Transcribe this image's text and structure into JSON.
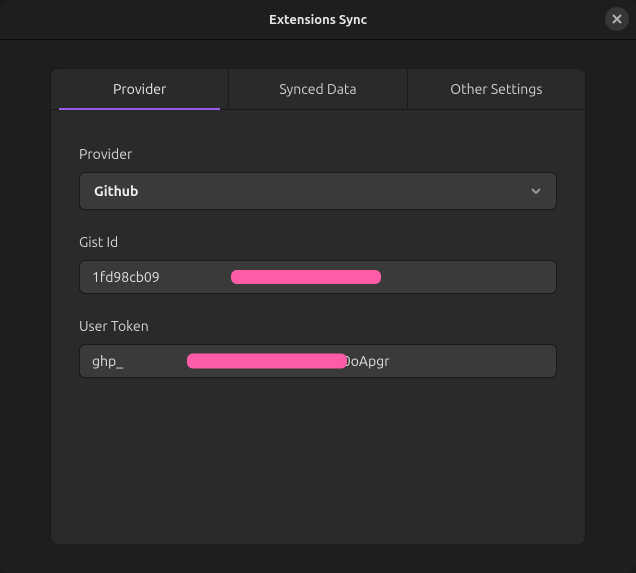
{
  "window": {
    "title": "Extensions Sync"
  },
  "tabs": {
    "provider": "Provider",
    "synced_data": "Synced Data",
    "other_settings": "Other Settings"
  },
  "fields": {
    "provider": {
      "label": "Provider",
      "value": "Github"
    },
    "gist_id": {
      "label": "Gist Id",
      "value": "1fd98cb09                                   b906"
    },
    "user_token": {
      "label": "User Token",
      "value": "ghp_                                      MDbQUu3bS080oApgr"
    }
  }
}
